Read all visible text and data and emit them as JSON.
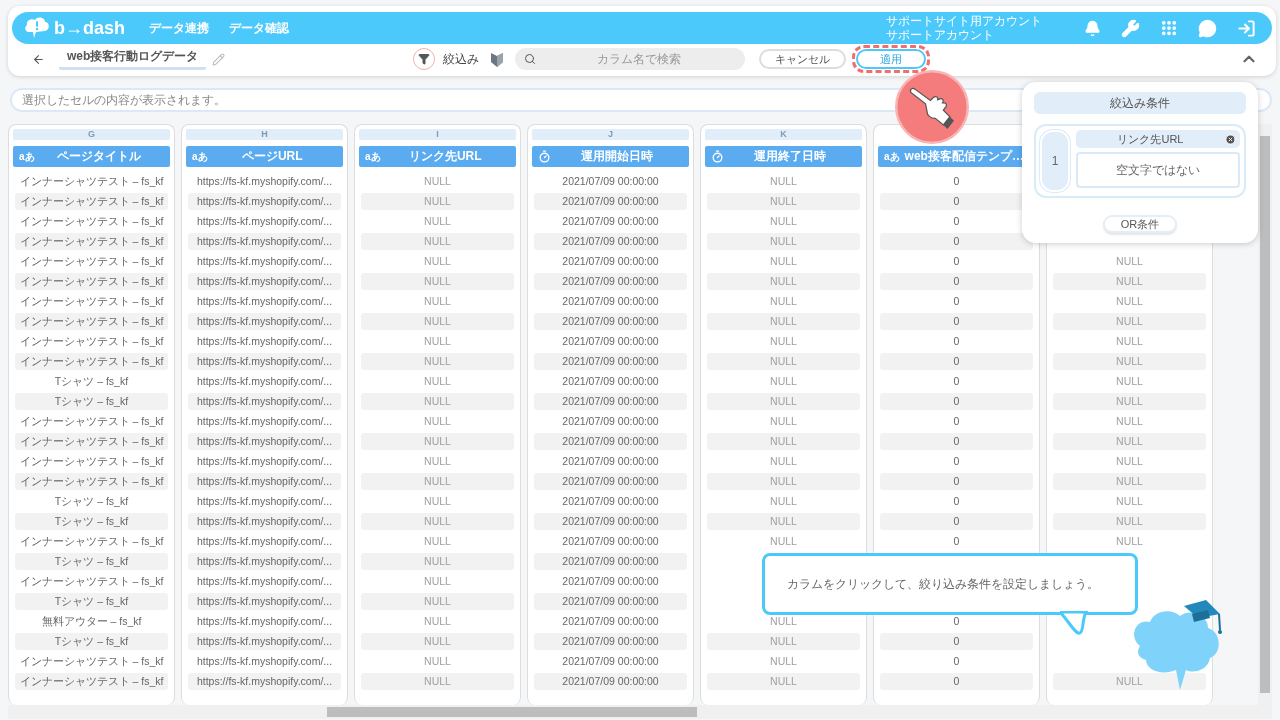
{
  "topbar": {
    "logo": "b→dash",
    "nav": [
      "データ連携",
      "データ確認"
    ],
    "account": [
      "サポートサイト用アカウント",
      "サポートアカウント"
    ]
  },
  "toolbar": {
    "title": "web接客行動ログデータ",
    "filter_label": "絞込み",
    "search": {
      "placeholder": "カラム名で検索"
    },
    "cancel": "キャンセル",
    "apply": "適用"
  },
  "cell_viewer": {
    "placeholder": "選択したセルの内容が表示されます。"
  },
  "columns": [
    {
      "letter": "G",
      "title": "ページタイトル",
      "kind": "text",
      "type_label": "aあ",
      "muted": false
    },
    {
      "letter": "H",
      "title": "ページURL",
      "kind": "text",
      "type_label": "aあ",
      "muted": false
    },
    {
      "letter": "I",
      "title": "リンク先URL",
      "kind": "text",
      "type_label": "aあ",
      "muted": true
    },
    {
      "letter": "J",
      "title": "運用開始日時",
      "kind": "datetime",
      "muted": false
    },
    {
      "letter": "K",
      "title": "運用終了日時",
      "kind": "datetime",
      "muted": true
    },
    {
      "title": "web接客配信テンプ…",
      "kind": "text",
      "type_label": "aあ",
      "muted": false
    },
    {
      "kind": "hidden",
      "muted": true
    }
  ],
  "rows": [
    [
      "インナーシャツテスト – fs_kf",
      "https://fs-kf.myshopify.com/...",
      "NULL",
      "2021/07/09 00:00:00",
      "NULL",
      "0",
      null
    ],
    [
      "インナーシャツテスト – fs_kf",
      "https://fs-kf.myshopify.com/...",
      "NULL",
      "2021/07/09 00:00:00",
      "NULL",
      "0",
      null
    ],
    [
      "インナーシャツテスト – fs_kf",
      "https://fs-kf.myshopify.com/...",
      "NULL",
      "2021/07/09 00:00:00",
      "NULL",
      "0",
      null
    ],
    [
      "インナーシャツテスト – fs_kf",
      "https://fs-kf.myshopify.com/...",
      "NULL",
      "2021/07/09 00:00:00",
      "NULL",
      "0",
      null
    ],
    [
      "インナーシャツテスト – fs_kf",
      "https://fs-kf.myshopify.com/...",
      "NULL",
      "2021/07/09 00:00:00",
      "NULL",
      "0",
      "NULL"
    ],
    [
      "インナーシャツテスト – fs_kf",
      "https://fs-kf.myshopify.com/...",
      "NULL",
      "2021/07/09 00:00:00",
      "NULL",
      "0",
      "NULL"
    ],
    [
      "インナーシャツテスト – fs_kf",
      "https://fs-kf.myshopify.com/...",
      "NULL",
      "2021/07/09 00:00:00",
      "NULL",
      "0",
      "NULL"
    ],
    [
      "インナーシャツテスト – fs_kf",
      "https://fs-kf.myshopify.com/...",
      "NULL",
      "2021/07/09 00:00:00",
      "NULL",
      "0",
      "NULL"
    ],
    [
      "インナーシャツテスト – fs_kf",
      "https://fs-kf.myshopify.com/...",
      "NULL",
      "2021/07/09 00:00:00",
      "NULL",
      "0",
      "NULL"
    ],
    [
      "インナーシャツテスト – fs_kf",
      "https://fs-kf.myshopify.com/...",
      "NULL",
      "2021/07/09 00:00:00",
      "NULL",
      "0",
      "NULL"
    ],
    [
      "Tシャツ – fs_kf",
      "https://fs-kf.myshopify.com/...",
      "NULL",
      "2021/07/09 00:00:00",
      "NULL",
      "0",
      "NULL"
    ],
    [
      "Tシャツ – fs_kf",
      "https://fs-kf.myshopify.com/...",
      "NULL",
      "2021/07/09 00:00:00",
      "NULL",
      "0",
      "NULL"
    ],
    [
      "インナーシャツテスト – fs_kf",
      "https://fs-kf.myshopify.com/...",
      "NULL",
      "2021/07/09 00:00:00",
      "NULL",
      "0",
      "NULL"
    ],
    [
      "インナーシャツテスト – fs_kf",
      "https://fs-kf.myshopify.com/...",
      "NULL",
      "2021/07/09 00:00:00",
      "NULL",
      "0",
      "NULL"
    ],
    [
      "インナーシャツテスト – fs_kf",
      "https://fs-kf.myshopify.com/...",
      "NULL",
      "2021/07/09 00:00:00",
      "NULL",
      "0",
      "NULL"
    ],
    [
      "インナーシャツテスト – fs_kf",
      "https://fs-kf.myshopify.com/...",
      "NULL",
      "2021/07/09 00:00:00",
      "NULL",
      "0",
      "NULL"
    ],
    [
      "Tシャツ – fs_kf",
      "https://fs-kf.myshopify.com/...",
      "NULL",
      "2021/07/09 00:00:00",
      "NULL",
      "0",
      "NULL"
    ],
    [
      "Tシャツ – fs_kf",
      "https://fs-kf.myshopify.com/...",
      "NULL",
      "2021/07/09 00:00:00",
      "NULL",
      "0",
      "NULL"
    ],
    [
      "インナーシャツテスト – fs_kf",
      "https://fs-kf.myshopify.com/...",
      "NULL",
      "2021/07/09 00:00:00",
      "NULL",
      "0",
      "NULL"
    ],
    [
      "Tシャツ – fs_kf",
      "https://fs-kf.myshopify.com/...",
      "NULL",
      "2021/07/09 00:00:00",
      null,
      null,
      null
    ],
    [
      "インナーシャツテスト – fs_kf",
      "https://fs-kf.myshopify.com/...",
      "NULL",
      "2021/07/09 00:00:00",
      null,
      null,
      null
    ],
    [
      "Tシャツ – fs_kf",
      "https://fs-kf.myshopify.com/...",
      "NULL",
      "2021/07/09 00:00:00",
      null,
      null,
      null
    ],
    [
      "無料アウター – fs_kf",
      "https://fs-kf.myshopify.com/...",
      "NULL",
      "2021/07/09 00:00:00",
      "NULL",
      "0",
      null
    ],
    [
      "Tシャツ – fs_kf",
      "https://fs-kf.myshopify.com/...",
      "NULL",
      "2021/07/09 00:00:00",
      "NULL",
      "0",
      null
    ],
    [
      "インナーシャツテスト – fs_kf",
      "https://fs-kf.myshopify.com/...",
      "NULL",
      "2021/07/09 00:00:00",
      "NULL",
      "0",
      null
    ],
    [
      "インナーシャツテスト – fs_kf",
      "https://fs-kf.myshopify.com/...",
      "NULL",
      "2021/07/09 00:00:00",
      "NULL",
      "0",
      "NULL"
    ]
  ],
  "filter_panel": {
    "title": "絞込み条件",
    "conditions": [
      {
        "index": "1",
        "column": "リンク先URL",
        "rule": "空文字ではない"
      }
    ],
    "or_button": "OR条件"
  },
  "hint_bubble": {
    "text": "カラムをクリックして、絞り込み条件を設定しましょう。"
  }
}
